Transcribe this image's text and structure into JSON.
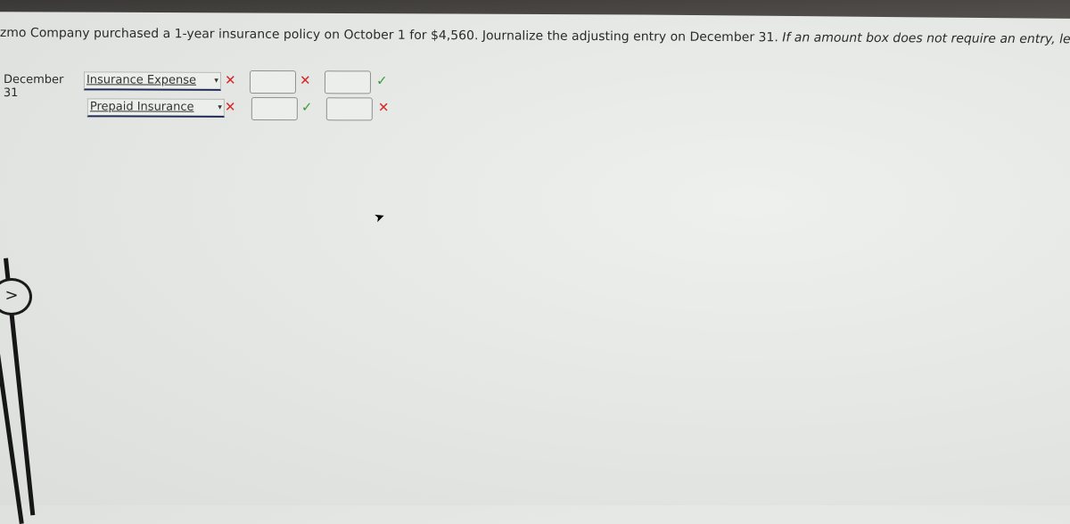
{
  "question": {
    "text": "zmo Company purchased a 1-year insurance policy on October 1 for $4,560. Journalize the adjusting entry on December 31.",
    "instruction": "If an amount box does not require an entry, leave it blank."
  },
  "journal": {
    "date": "December 31",
    "rows": [
      {
        "account": "Insurance Expense",
        "account_status": "incorrect",
        "debit_value": "",
        "debit_status": "incorrect",
        "credit_value": "",
        "credit_status": "correct"
      },
      {
        "account": "Prepaid Insurance",
        "account_status": "incorrect",
        "debit_value": "",
        "debit_status": "correct",
        "credit_value": "",
        "credit_status": "incorrect"
      }
    ]
  },
  "icons": {
    "incorrect": "✕",
    "correct": "✓",
    "dropdown": "▾",
    "next": ">",
    "cursor": "➤"
  },
  "colors": {
    "incorrect": "#d42a2a",
    "correct": "#3a9a3a"
  }
}
